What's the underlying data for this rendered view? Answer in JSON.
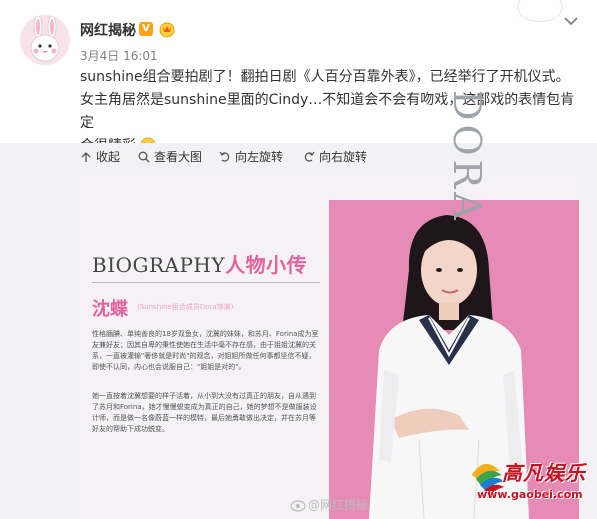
{
  "post": {
    "author": "网红揭秘",
    "verified_mark": "V",
    "time": "3月4日 16:01",
    "text_line1": "sunshine组合要拍剧了！翻拍日剧《人百分百靠外表》，已经举行了开机仪式。",
    "text_line2": "女主角居然是sunshine里面的Cindy…不知道会不会有吻戏，这部戏的表情包肯定",
    "text_line3": "会很精彩"
  },
  "toolbar": {
    "collapse": "收起",
    "view_large": "查看大图",
    "rotate_left": "向左旋转",
    "rotate_right": "向右旋转"
  },
  "image": {
    "bio_title": "BIOGRAPHY",
    "bio_title_cn": "人物小传",
    "bio_name": "沈蝶",
    "bio_name_sub": "(Sunshine组合成员Dora饰演)",
    "bio_para1": "性格腼腆、单纯善良的18岁双鱼女，沈冀的妹妹，和苏月、Forina成为室友兼好友；因其自卑的秉性使她在生活中毫不存在感，由于姐姐沈冀的关系，一直被灌输\"奢侈就是时尚\"的观念，对姐姐所做任何事都坚信不疑，即使不认同，内心也会说服自己：\"姐姐是对的\"。",
    "bio_para2": "她一直按着沈冀想要的样子活着，从小到大没有过真正的朋友，自从遇到了苏月和Forina，她才慢慢蜕变成为真正的自己，她的梦想不是做服装设计师，而是做一名像蔚蓝一样的模特，最后她勇敢做出决定，并在苏月等好友的帮助下成功蜕变。",
    "side_text": "DORA",
    "watermark": "@网红揭秘",
    "logo_text": "高凡娱乐",
    "logo_url": "www.gaobei.com"
  },
  "colors": {
    "accent_pink": "#e5629b",
    "pink_bg": "#e68ab6",
    "logo_red": "#c8111e"
  },
  "icons": [
    "avatar-rabbit",
    "verified-icon",
    "vip-badge-icon",
    "chevron-down-icon",
    "arrow-up-icon",
    "search-icon",
    "rotate-left-icon",
    "rotate-right-icon",
    "laugh-emoji-icon"
  ]
}
